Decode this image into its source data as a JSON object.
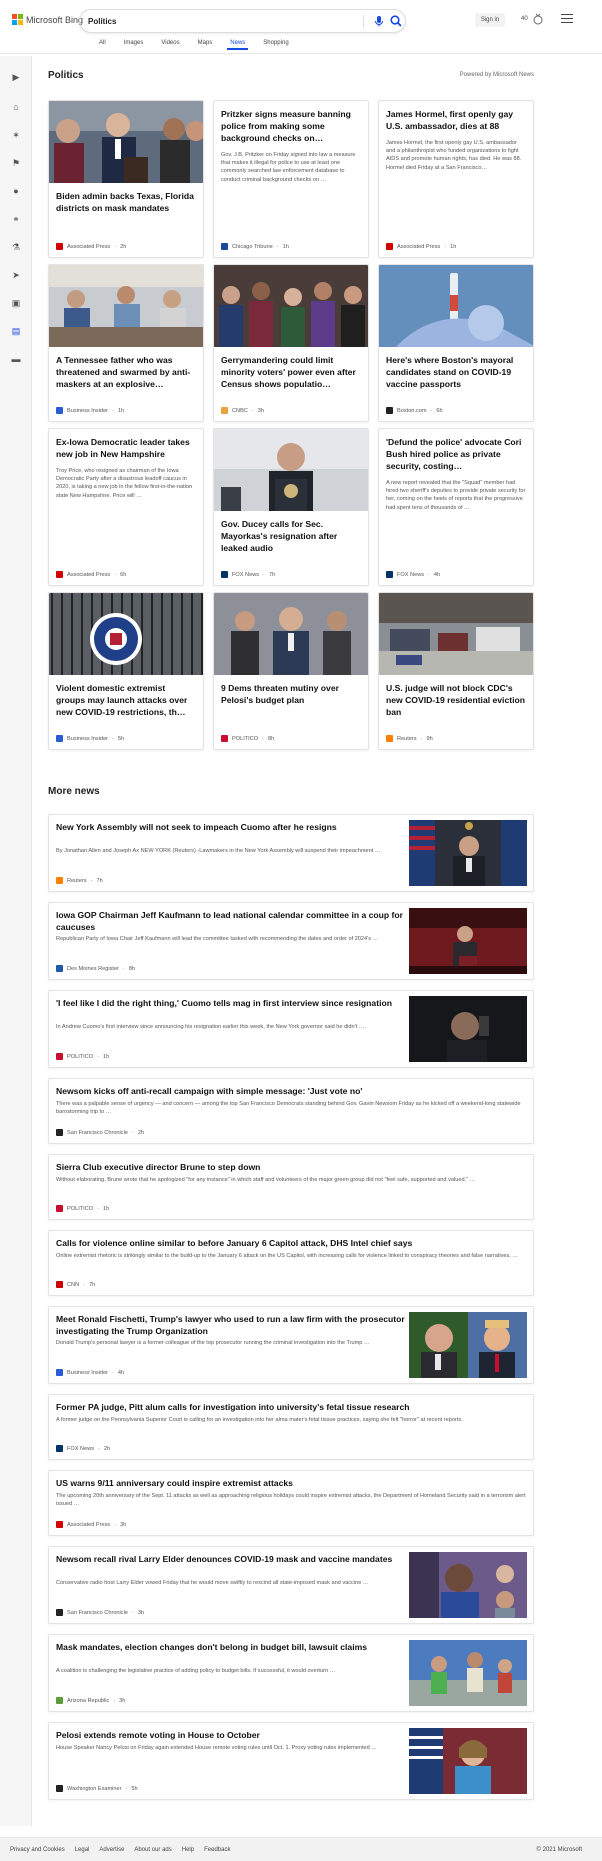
{
  "brand": {
    "name": "Microsoft Bing"
  },
  "search": {
    "query": "Politics"
  },
  "header": {
    "signin": "Sign in",
    "rewards_points": "40"
  },
  "scopes": [
    {
      "label": "All"
    },
    {
      "label": "Images"
    },
    {
      "label": "Videos"
    },
    {
      "label": "Maps"
    },
    {
      "label": "News",
      "active": true
    },
    {
      "label": "Shopping"
    }
  ],
  "section": {
    "title": "Politics",
    "powered_by": "Powered by Microsoft News"
  },
  "cards": [
    {
      "title": "Biden admin backs Texas, Florida districts on mask mandates",
      "snippet": "",
      "source": "Associated Press",
      "age": "2h",
      "src_color": "#d40000",
      "image": "desantis-podium"
    },
    {
      "title": "Pritzker signs measure banning police from making some background checks on…",
      "snippet": "Gov. J.B. Pritzker on Friday signed into law a measure that makes it illegal for police to use at least one commonly searched law enforcement database to conduct criminal background checks on …",
      "source": "Chicago Tribune",
      "age": "1h",
      "src_color": "#1a4b9b",
      "image": ""
    },
    {
      "title": "James Hormel, first openly gay U.S. ambassador, dies at 88",
      "snippet": "James Hormel, the first openly gay U.S. ambassador and a philanthropist who funded organizations to fight AIDS and promote human rights, has died. He was 88. Hormel died Friday at a San Francisco…",
      "source": "Associated Press",
      "age": "1h",
      "src_color": "#d40000",
      "image": ""
    },
    {
      "title": "A Tennessee father who was threatened and swarmed by anti-maskers at an explosive…",
      "snippet": "",
      "source": "Business Insider",
      "age": "1h",
      "src_color": "#2a5cd6",
      "image": "classroom"
    },
    {
      "title": "Gerrymandering could limit minority voters' power even after Census shows populatio…",
      "snippet": "",
      "source": "CNBC",
      "age": "3h",
      "src_color": "#e8a33c",
      "image": "crowd"
    },
    {
      "title": "Here's where Boston's mayoral candidates stand on COVID-19 vaccine passports",
      "snippet": "",
      "source": "Boston.com",
      "age": "6h",
      "src_color": "#222222",
      "image": "vaccine"
    },
    {
      "title": "Ex-Iowa Democratic leader takes new job in New Hampshire",
      "snippet": "Troy Price, who resigned as chairman of the Iowa Democratic Party after a disastrous leadoff caucus in 2020, is taking a new job in the fellow first-in-the-nation state New Hampshire. Price will …",
      "source": "Associated Press",
      "age": "6h",
      "src_color": "#d40000",
      "image": ""
    },
    {
      "title": "Gov. Ducey calls for Sec. Mayorkas's resignation after leaked audio",
      "snippet": "",
      "source": "FOX News",
      "age": "7h",
      "src_color": "#003366",
      "image": "mayorkas"
    },
    {
      "title": "'Defund the police' advocate Cori Bush hired police as private security, costing…",
      "snippet": "A new report revealed that the \"Squad\" member had hired two sheriff's deputies to provide private security for her, coming on the heels of reports that the progressive had spent tens of thousands of …",
      "source": "FOX News",
      "age": "4h",
      "src_color": "#003366",
      "image": ""
    },
    {
      "title": "Violent domestic extremist groups may launch attacks over new COVID-19 restrictions, th…",
      "snippet": "",
      "source": "Business Insider",
      "age": "5h",
      "src_color": "#2a5cd6",
      "image": "dhs-seal"
    },
    {
      "title": "9 Dems threaten mutiny over Pelosi's budget plan",
      "snippet": "",
      "source": "POLITICO",
      "age": "8h",
      "src_color": "#c8102e",
      "image": "gottheimer"
    },
    {
      "title": "U.S. judge will not block CDC's new COVID-19 residential eviction ban",
      "snippet": "",
      "source": "Reuters",
      "age": "9h",
      "src_color": "#ff8000",
      "image": "eviction"
    }
  ],
  "more_news": {
    "title": "More news",
    "items": [
      {
        "title": "New York Assembly will not seek to impeach Cuomo after he resigns",
        "snippet": "By Jonathan Allen and Joseph Ax NEW YORK (Reuters) -Lawmakers in the New York Assembly will suspend their impeachment …",
        "source": "Reuters",
        "age": "7h",
        "src_color": "#ff8000",
        "image": "cuomo-flags"
      },
      {
        "title": "Iowa GOP Chairman Jeff Kaufmann to lead national calendar committee in a coup for caucuses",
        "snippet": "Republican Party of Iowa Chair Jeff Kaufmann will lead the committee tasked with recommending the dates and order of 2024's …",
        "source": "Des Moines Register",
        "age": "8h",
        "src_color": "#1e5aa8",
        "image": "kaufmann-stage"
      },
      {
        "title": "'I feel like I did the right thing,' Cuomo tells mag in first interview since resignation",
        "snippet": "In Andrew Cuomo's first interview since announcing his resignation earlier this week, the New York governor said he didn't …",
        "source": "POLITICO",
        "age": "1h",
        "src_color": "#c8102e",
        "image": "cuomo-dark"
      },
      {
        "title": "Newsom kicks off anti-recall campaign with simple message: 'Just vote no'",
        "snippet": "There was a palpable sense of urgency — and concern — among the top San Francisco Democrats standing behind Gov. Gavin Newsom Friday as he kicked off a weekend-long statewide barnstorming trip to …",
        "source": "San Francisco Chronicle",
        "age": "2h",
        "src_color": "#222222",
        "image": ""
      },
      {
        "title": "Sierra Club executive director Brune to step down",
        "snippet": "Without elaborating, Brune wrote that he apologized \"for any instance\" in which staff and volunteers of the major green group did not \"feel safe, supported and valued.\" …",
        "source": "POLITICO",
        "age": "1h",
        "src_color": "#c8102e",
        "image": ""
      },
      {
        "title": "Calls for violence online similar to before January 6 Capitol attack, DHS Intel chief says",
        "snippet": "Online extremist rhetoric is strikingly similar to the build-up to the January 6 attack on the US Capitol, with increasing calls for violence linked to conspiracy theories and false narratives, …",
        "source": "CNN",
        "age": "7h",
        "src_color": "#cc0000",
        "image": ""
      },
      {
        "title": "Meet Ronald Fischetti, Trump's lawyer who used to run a law firm with the prosecutor investigating the Trump Organization",
        "snippet": "Donald Trump's personal lawyer is a former colleague of the top prosecutor running the criminal investigation into the Trump …",
        "source": "Business Insider",
        "age": "4h",
        "src_color": "#2a5cd6",
        "image": "fischetti-trump"
      },
      {
        "title": "Former PA judge, Pitt alum calls for investigation into university's fetal tissue research",
        "snippet": "A former judge on the Pennsylvania Superior Court is calling for an investigation into her alma mater's fetal tissue practices, saying she felt \"horror\" at recent reports.",
        "source": "FOX News",
        "age": "2h",
        "src_color": "#003366",
        "image": ""
      },
      {
        "title": "US warns 9/11 anniversary could inspire extremist attacks",
        "snippet": "The upcoming 20th anniversary of the Sept. 11 attacks as well as approaching religious holidays could inspire extremist attacks, the Department of Homeland Security said in a terrorism alert issued …",
        "source": "Associated Press",
        "age": "3h",
        "src_color": "#d40000",
        "image": ""
      },
      {
        "title": "Newsom recall rival Larry Elder denounces COVID-19 mask and vaccine mandates",
        "snippet": "Conservative radio host Larry Elder vowed Friday that he would move swiftly to rescind all state-imposed mask and vaccine …",
        "source": "San Francisco Chronicle",
        "age": "3h",
        "src_color": "#222222",
        "image": "elder"
      },
      {
        "title": "Mask mandates, election changes don't belong in budget bill, lawsuit claims",
        "snippet": "A coalition is challenging the legislative practice of adding policy to budget bills. If successful, it would overturn …",
        "source": "Arizona Republic",
        "age": "3h",
        "src_color": "#5a9e3a",
        "image": "kids-masks"
      },
      {
        "title": "Pelosi extends remote voting in House to October",
        "snippet": "House Speaker Nancy Pelosi on Friday again extended House remote voting rules until Oct. 1. Proxy voting rules implemented …",
        "source": "Washington Examiner",
        "age": "5h",
        "src_color": "#222222",
        "image": "pelosi"
      }
    ]
  },
  "footer": {
    "links": [
      "Privacy and Cookies",
      "Legal",
      "Advertise",
      "About our ads",
      "Help",
      "Feedback"
    ],
    "copyright": "© 2021 Microsoft"
  }
}
